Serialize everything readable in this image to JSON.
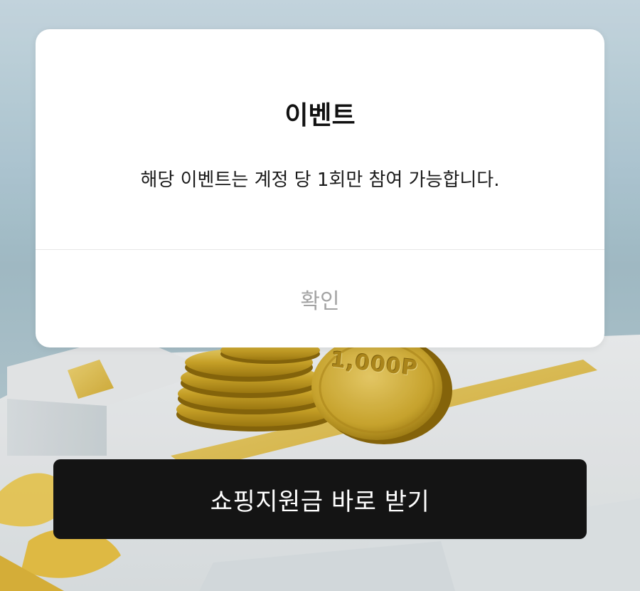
{
  "dialog": {
    "title": "이벤트",
    "message": "해당 이벤트는 계정 당 1회만 참여 가능합니다.",
    "confirm_label": "확인"
  },
  "background": {
    "coin_label": "1,000P"
  },
  "cta": {
    "label": "쇼핑지원금 바로 받기"
  },
  "colors": {
    "cta_background": "#141414",
    "dialog_background": "#ffffff",
    "confirm_text": "#a3a3a3",
    "ribbon": "#e9c54a",
    "coin": "#d4af2c"
  }
}
